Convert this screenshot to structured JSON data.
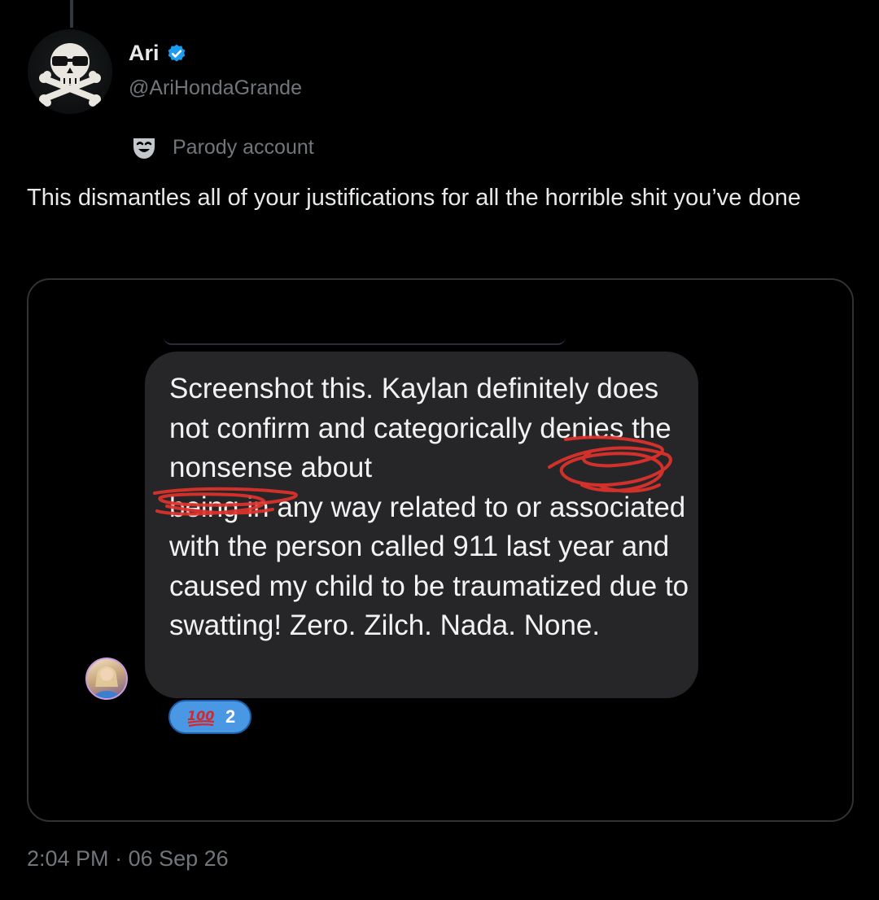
{
  "author": {
    "display_name": "Ari",
    "handle": "@AriHondaGrande",
    "verified": true,
    "label": "Parody account",
    "avatar_icon": "skull-crossbones-icon",
    "label_icon": "theater-mask-icon"
  },
  "tweet": {
    "text": "This dismantles all of your justifications for all the horrible shit you’ve done",
    "timestamp": "2:04 PM",
    "date": "06 Sep 26",
    "separator": "·"
  },
  "media": {
    "message_text": "Screenshot this. Kaylan definitely does not confirm and categorically denies the nonsense about\nbeing in any way related to or associated with the person called 911 last year and caused my child to be traumatized  due to swatting! Zero. Zilch. Nada. None.",
    "reaction_emoji": "hundred-points-icon",
    "reaction_count": "2",
    "colors": {
      "bubble": "#262628",
      "reaction_pill": "#4a97e3",
      "redaction": "#e0322b",
      "verified": "#1d9bf0"
    }
  }
}
